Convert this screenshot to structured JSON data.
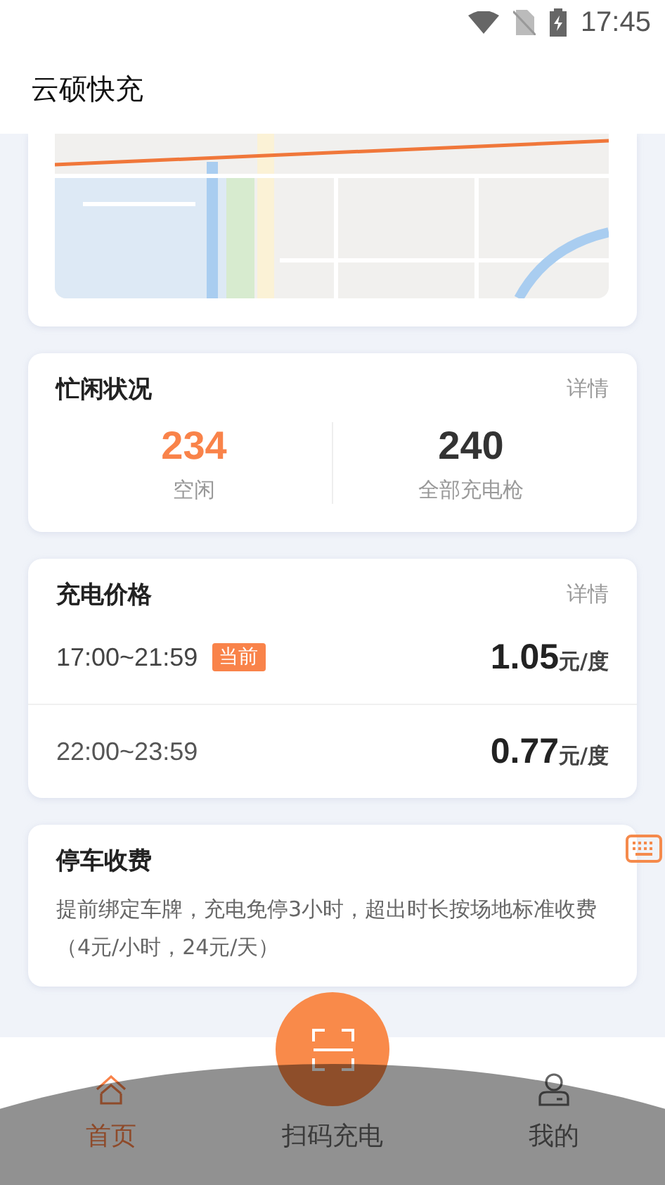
{
  "status_bar": {
    "time": "17:45"
  },
  "header": {
    "title": "云硕快充"
  },
  "availability": {
    "title": "忙闲状况",
    "link": "详情",
    "stats": [
      {
        "value": "234",
        "label": "空闲",
        "kind": "highlight"
      },
      {
        "value": "240",
        "label": "全部充电枪",
        "kind": "plain"
      }
    ]
  },
  "pricing": {
    "title": "充电价格",
    "link": "详情",
    "rows": [
      {
        "time": "17:00~21:59",
        "badge": "当前",
        "price": "1.05",
        "unit": "元/度",
        "selected": true
      },
      {
        "time": "22:00~23:59",
        "price": "0.77",
        "unit": "元/度",
        "selected": false
      }
    ]
  },
  "parking": {
    "title": "停车收费",
    "text": "提前绑定车牌，充电免停3小时，超出时长按场地标准收费（4元/小时，24元/天）"
  },
  "tab_bar": {
    "items": [
      {
        "label": "首页",
        "kind": "home",
        "selected": true
      },
      {
        "label": "扫码充电",
        "kind": "scan",
        "selected": false
      },
      {
        "label": "我的",
        "kind": "profile",
        "selected": false
      }
    ]
  }
}
